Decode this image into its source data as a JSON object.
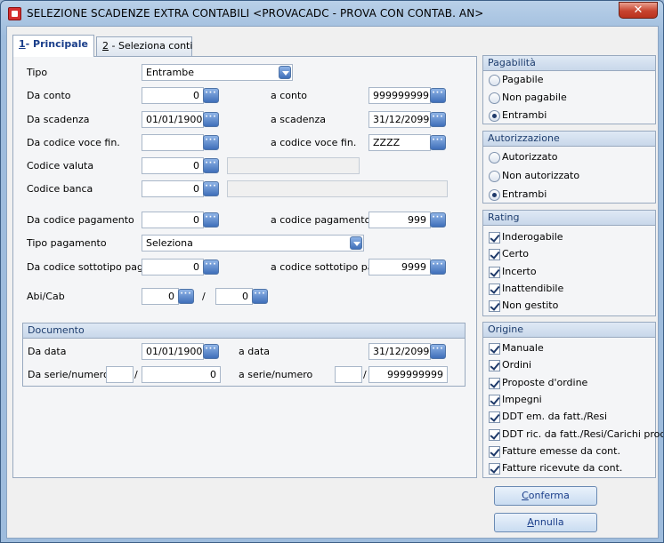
{
  "window": {
    "title": "SELEZIONE SCADENZE EXTRA CONTABILI <PROVACADC - PROVA CON CONTAB. AN>",
    "close_label": "✕"
  },
  "tabs": [
    {
      "hotkey": "1",
      "label": "- Principale"
    },
    {
      "hotkey": "2",
      "label": " - Seleziona conti"
    }
  ],
  "form": {
    "tipo": {
      "label": "Tipo",
      "value": "Entrambe"
    },
    "conto": {
      "label_from": "Da conto",
      "from": "0",
      "label_to": "a conto",
      "to": "999999999"
    },
    "scadenza": {
      "label_from": "Da scadenza",
      "from": "01/01/1900",
      "label_to": "a scadenza",
      "to": "31/12/2099"
    },
    "voce_fin": {
      "label_from": "Da codice voce fin.",
      "from": "",
      "label_to": "a codice voce fin.",
      "to": "ZZZZ"
    },
    "valuta": {
      "label": "Codice valuta",
      "value": "0",
      "desc": ""
    },
    "banca": {
      "label": "Codice banca",
      "value": "0",
      "desc": ""
    },
    "pagamento": {
      "label_from": "Da codice pagamento",
      "from": "0",
      "label_to": "a codice pagamento",
      "to": "999"
    },
    "tipo_pagamento": {
      "label": "Tipo pagamento",
      "value": "Seleziona"
    },
    "sottotipo": {
      "label_from": "Da codice sottotipo pag.",
      "from": "0",
      "label_to": "a codice sottotipo pag.",
      "to": "9999"
    },
    "abicab": {
      "label": "Abi/Cab",
      "abi": "0",
      "sep": "/",
      "cab": "0"
    }
  },
  "documento": {
    "title": "Documento",
    "data": {
      "label_from": "Da data",
      "from": "01/01/1900",
      "label_to": "a data",
      "to": "31/12/2099"
    },
    "serie": {
      "label_from": "Da serie/numero",
      "from_serie": "",
      "from_num": "0",
      "label_to": "a serie/numero",
      "to_serie": "",
      "to_num": "999999999",
      "sep": "/"
    }
  },
  "pagabilita": {
    "title": "Pagabilità",
    "options": [
      "Pagabile",
      "Non pagabile",
      "Entrambi"
    ],
    "selected": "Entrambi"
  },
  "autorizzazione": {
    "title": "Autorizzazione",
    "options": [
      "Autorizzato",
      "Non autorizzato",
      "Entrambi"
    ],
    "selected": "Entrambi"
  },
  "rating": {
    "title": "Rating",
    "items": [
      "Inderogabile",
      "Certo",
      "Incerto",
      "Inattendibile",
      "Non gestito"
    ]
  },
  "origine": {
    "title": "Origine",
    "items": [
      "Manuale",
      "Ordini",
      "Proposte d'ordine",
      "Impegni",
      "DDT em. da fatt./Resi",
      "DDT ric. da fatt./Resi/Carichi prod.",
      "Fatture emesse da cont.",
      "Fatture ricevute da cont."
    ]
  },
  "buttons": {
    "confirm": {
      "hotkey": "C",
      "rest": "onferma"
    },
    "cancel": {
      "hotkey": "A",
      "rest": "nnulla"
    }
  },
  "icons": {
    "picker": "ellipsis-icon",
    "dropdown": "chevron-down-icon",
    "app": "app-icon",
    "close": "close-icon"
  }
}
